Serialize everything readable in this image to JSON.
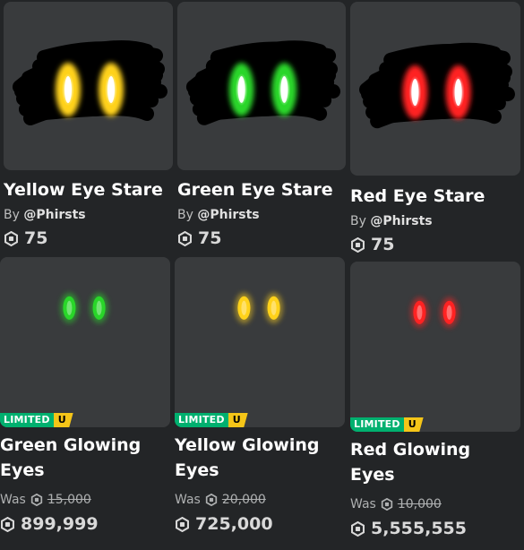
{
  "colors": {
    "background": "#232527",
    "card": "#393b3d",
    "limited_green": "#00b06f",
    "unique_yellow": "#f5c518",
    "yellow_eye": "#ffd21a",
    "green_eye": "#29d629",
    "red_eye": "#ff2222"
  },
  "robux_icon": "robux-icon",
  "items": [
    {
      "name": "Yellow Eye Stare",
      "by_label": "By",
      "creator": "@Phirsts",
      "price": "75",
      "eye_color": "yellow",
      "style": "stare"
    },
    {
      "name": "Green Eye Stare",
      "by_label": "By",
      "creator": "@Phirsts",
      "price": "75",
      "eye_color": "green",
      "style": "stare"
    },
    {
      "name": "Red Eye Stare",
      "by_label": "By",
      "creator": "@Phirsts",
      "price": "75",
      "eye_color": "red",
      "style": "stare"
    },
    {
      "name_line1": "Green Glowing",
      "name_line2": "Eyes",
      "badge": "LIMITED",
      "badge_u": "U",
      "was_label": "Was",
      "was_price": "15,000",
      "price": "899,999",
      "eye_color": "green",
      "style": "glow"
    },
    {
      "name_line1": "Yellow Glowing",
      "name_line2": "Eyes",
      "badge": "LIMITED",
      "badge_u": "U",
      "was_label": "Was",
      "was_price": "20,000",
      "price": "725,000",
      "eye_color": "yellow",
      "style": "glow"
    },
    {
      "name_line1": "Red Glowing",
      "name_line2": "Eyes",
      "badge": "LIMITED",
      "badge_u": "U",
      "was_label": "Was",
      "was_price": "10,000",
      "price": "5,555,555",
      "eye_color": "red",
      "style": "glow"
    }
  ]
}
